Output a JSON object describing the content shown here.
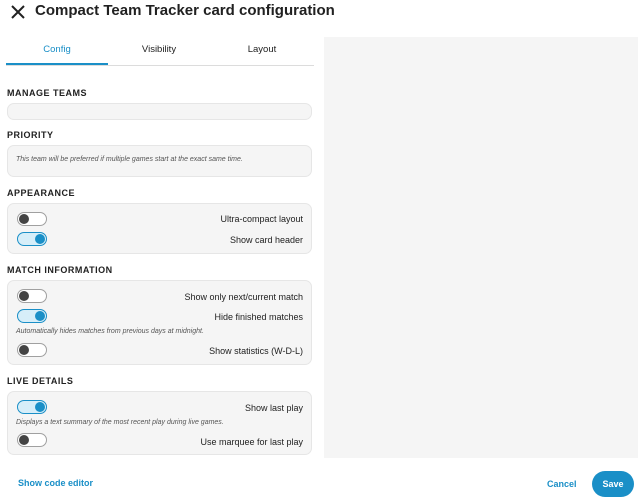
{
  "dialog": {
    "title": "Compact Team Tracker card configuration",
    "close_icon": "close-icon"
  },
  "tabs": [
    {
      "label": "Config",
      "active": true
    },
    {
      "label": "Visibility",
      "active": false
    },
    {
      "label": "Layout",
      "active": false
    }
  ],
  "sections": {
    "manage_teams": {
      "title": "MANAGE TEAMS"
    },
    "priority": {
      "title": "PRIORITY",
      "helper": "This team will be preferred if multiple games start at the exact same time."
    },
    "appearance": {
      "title": "APPEARANCE",
      "rows": [
        {
          "label": "Ultra-compact layout",
          "on": false
        },
        {
          "label": "Show card header",
          "on": true
        }
      ]
    },
    "match_information": {
      "title": "MATCH INFORMATION",
      "rows": [
        {
          "label": "Show only next/current match",
          "on": false
        },
        {
          "label": "Hide finished matches",
          "on": true
        },
        {
          "label": "Show statistics (W-D-L)",
          "on": false
        }
      ],
      "helper": "Automatically hides matches from previous days at midnight."
    },
    "live_details": {
      "title": "LIVE DETAILS",
      "rows": [
        {
          "label": "Show last play",
          "on": true
        },
        {
          "label": "Use marquee for last play",
          "on": false
        }
      ],
      "helper": "Displays a text summary of the most recent play during live games."
    }
  },
  "footer": {
    "code_editor_label": "Show code editor",
    "cancel_label": "Cancel",
    "save_label": "Save"
  },
  "colors": {
    "accent": "#1a8fc7",
    "panel_bg": "#f5f5f5"
  }
}
